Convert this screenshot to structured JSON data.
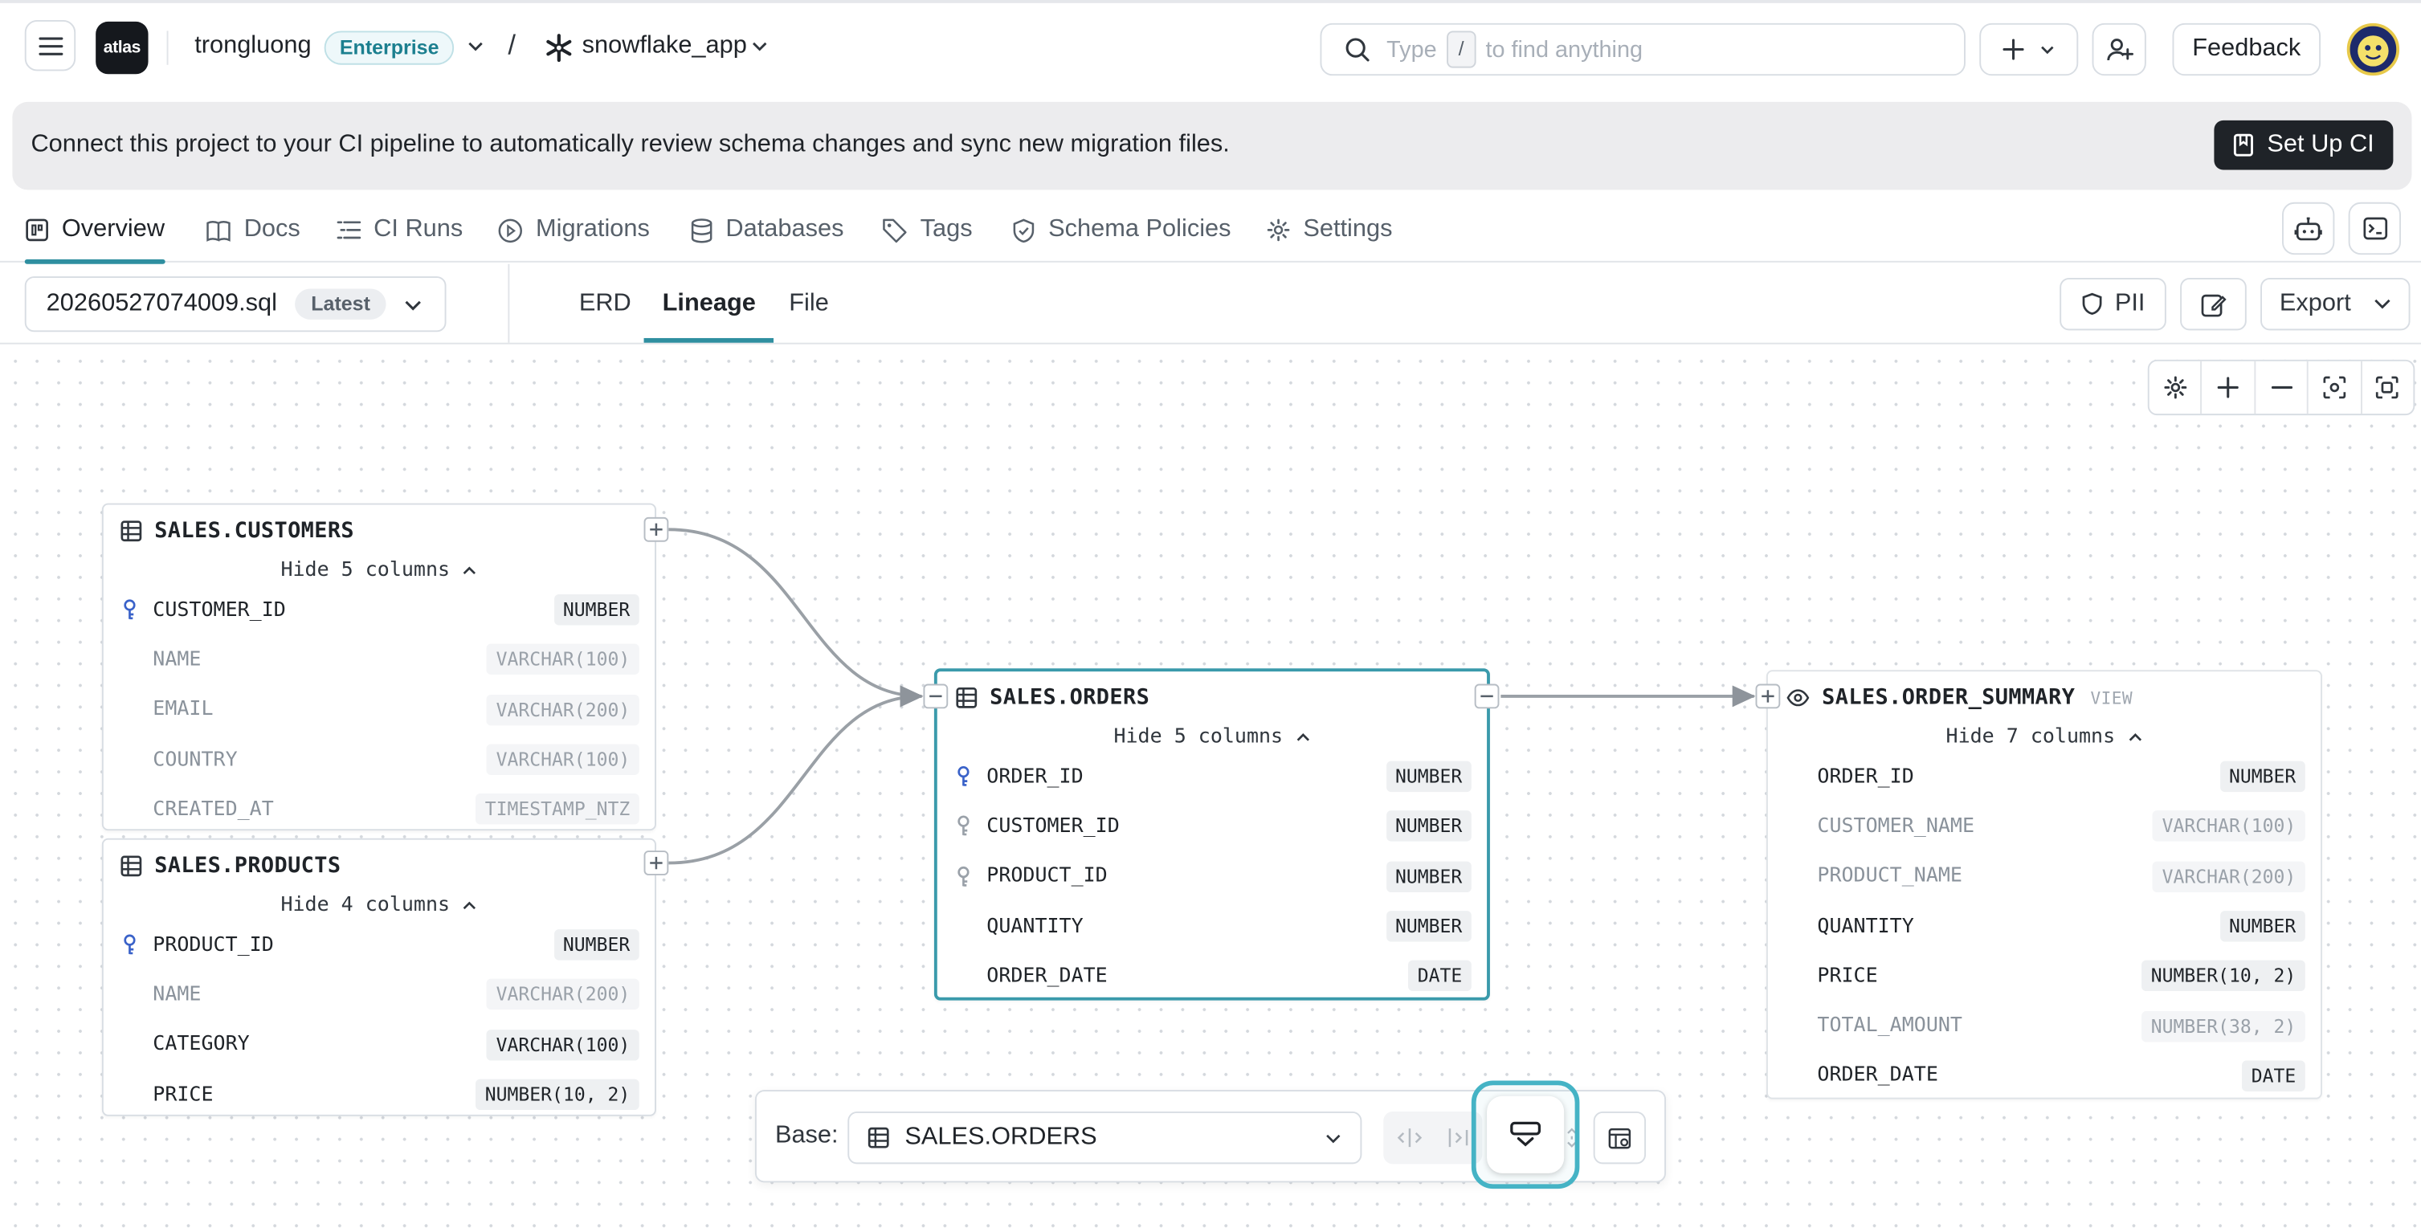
{
  "header": {
    "logo_text": "atlas",
    "org_name": "trongluong",
    "plan_badge": "Enterprise",
    "breadcrumb_separator": "/",
    "project_name": "snowflake_app",
    "search_prefix": "Type",
    "search_key": "/",
    "search_suffix": "to find anything",
    "feedback_label": "Feedback"
  },
  "banner": {
    "message": "Connect this project to your CI pipeline to automatically review schema changes and sync new migration files.",
    "button_label": "Set Up CI"
  },
  "nav_tabs": [
    {
      "label": "Overview",
      "icon": "overview-icon"
    },
    {
      "label": "Docs",
      "icon": "book-icon"
    },
    {
      "label": "CI Runs",
      "icon": "list-icon"
    },
    {
      "label": "Migrations",
      "icon": "play-circle-icon"
    },
    {
      "label": "Databases",
      "icon": "database-icon"
    },
    {
      "label": "Tags",
      "icon": "tag-icon"
    },
    {
      "label": "Schema Policies",
      "icon": "shield-check-icon"
    },
    {
      "label": "Settings",
      "icon": "gear-icon"
    }
  ],
  "active_nav_tab": "Overview",
  "file_selector": {
    "file": "20260527074009.sql",
    "badge": "Latest"
  },
  "view_tabs": [
    "ERD",
    "Lineage",
    "File"
  ],
  "active_view_tab": "Lineage",
  "toolbar": {
    "pii_label": "PII",
    "export_label": "Export"
  },
  "tables": [
    {
      "name": "SALES.CUSTOMERS",
      "hide_label": "Hide 5 columns",
      "columns": [
        {
          "name": "CUSTOMER_ID",
          "type": "NUMBER",
          "key": "primary",
          "dim": false
        },
        {
          "name": "NAME",
          "type": "VARCHAR(100)",
          "key": "",
          "dim": true
        },
        {
          "name": "EMAIL",
          "type": "VARCHAR(200)",
          "key": "",
          "dim": true
        },
        {
          "name": "COUNTRY",
          "type": "VARCHAR(100)",
          "key": "",
          "dim": true
        },
        {
          "name": "CREATED_AT",
          "type": "TIMESTAMP_NTZ",
          "key": "",
          "dim": true
        }
      ]
    },
    {
      "name": "SALES.PRODUCTS",
      "hide_label": "Hide 4 columns",
      "columns": [
        {
          "name": "PRODUCT_ID",
          "type": "NUMBER",
          "key": "primary",
          "dim": false
        },
        {
          "name": "NAME",
          "type": "VARCHAR(200)",
          "key": "",
          "dim": true
        },
        {
          "name": "CATEGORY",
          "type": "VARCHAR(100)",
          "key": "",
          "dim": false
        },
        {
          "name": "PRICE",
          "type": "NUMBER(10, 2)",
          "key": "",
          "dim": false
        }
      ]
    },
    {
      "name": "SALES.ORDERS",
      "hide_label": "Hide 5 columns",
      "columns": [
        {
          "name": "ORDER_ID",
          "type": "NUMBER",
          "key": "primary",
          "dim": false
        },
        {
          "name": "CUSTOMER_ID",
          "type": "NUMBER",
          "key": "foreign",
          "dim": false
        },
        {
          "name": "PRODUCT_ID",
          "type": "NUMBER",
          "key": "foreign",
          "dim": false
        },
        {
          "name": "QUANTITY",
          "type": "NUMBER",
          "key": "",
          "dim": false
        },
        {
          "name": "ORDER_DATE",
          "type": "DATE",
          "key": "",
          "dim": false
        }
      ]
    },
    {
      "name": "SALES.ORDER_SUMMARY",
      "view_tag": "VIEW",
      "hide_label": "Hide 7 columns",
      "columns": [
        {
          "name": "ORDER_ID",
          "type": "NUMBER",
          "key": "",
          "dim": false
        },
        {
          "name": "CUSTOMER_NAME",
          "type": "VARCHAR(100)",
          "key": "",
          "dim": true
        },
        {
          "name": "PRODUCT_NAME",
          "type": "VARCHAR(200)",
          "key": "",
          "dim": true
        },
        {
          "name": "QUANTITY",
          "type": "NUMBER",
          "key": "",
          "dim": false
        },
        {
          "name": "PRICE",
          "type": "NUMBER(10, 2)",
          "key": "",
          "dim": false
        },
        {
          "name": "TOTAL_AMOUNT",
          "type": "NUMBER(38, 2)",
          "key": "",
          "dim": true
        },
        {
          "name": "ORDER_DATE",
          "type": "DATE",
          "key": "",
          "dim": false
        }
      ]
    }
  ],
  "base_bar": {
    "label": "Base:",
    "selected": "SALES.ORDERS"
  },
  "colors": {
    "accent": "#2f8fa0",
    "focus_ring": "#45b3c5",
    "key_primary": "#3a62c9",
    "key_foreign": "#9aa1a9"
  }
}
